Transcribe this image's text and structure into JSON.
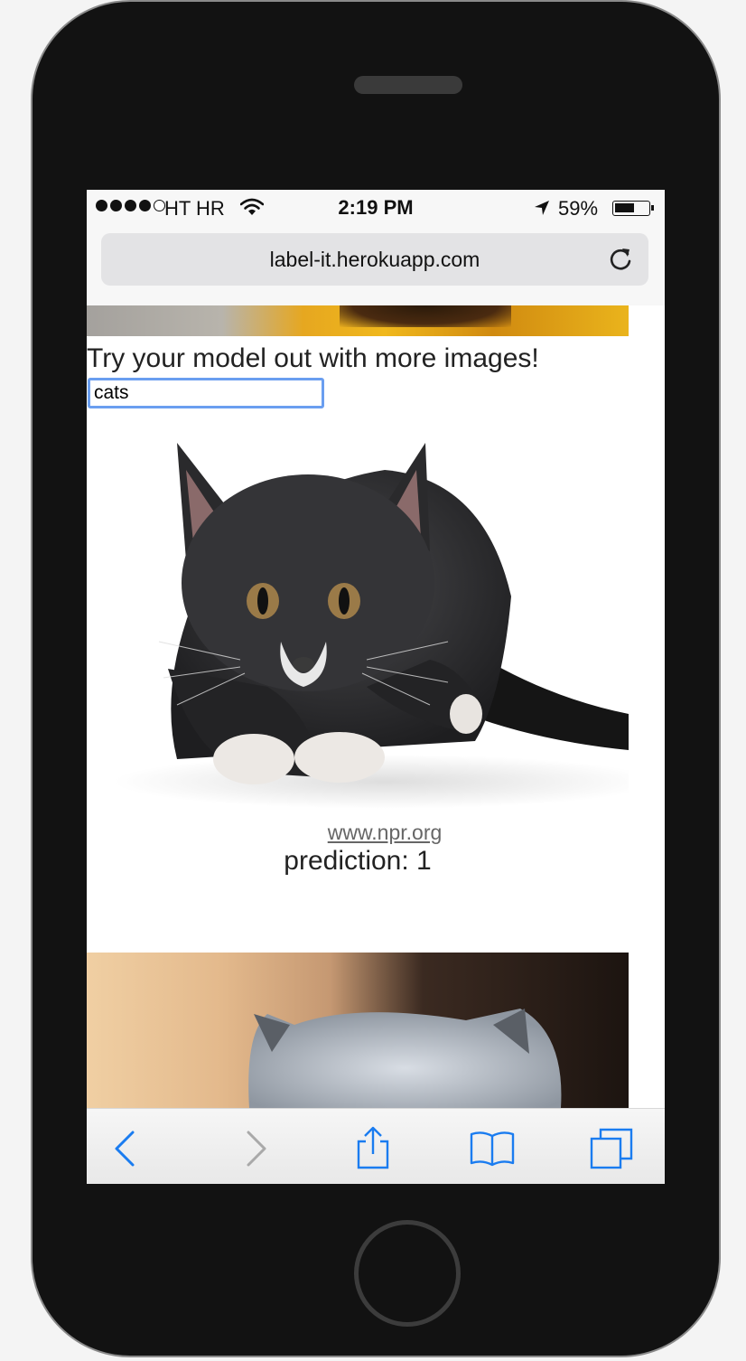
{
  "status_bar": {
    "carrier": "HT HR",
    "time": "2:19 PM",
    "battery_percent": "59%",
    "battery_level": 0.59,
    "icons": [
      "signal-dots",
      "wifi-icon",
      "location-arrow-icon",
      "battery-icon"
    ]
  },
  "address_bar": {
    "url": "label-it.herokuapp.com",
    "reload_icon": "reload-icon"
  },
  "page": {
    "headline": "Try your model out with more images!",
    "search_value": "cats",
    "results": [
      {
        "source": "www.npr.org",
        "prediction": "prediction: 1"
      }
    ]
  },
  "toolbar": {
    "icons": [
      "back-icon",
      "forward-icon",
      "share-icon",
      "bookmarks-icon",
      "tabs-icon"
    ]
  }
}
